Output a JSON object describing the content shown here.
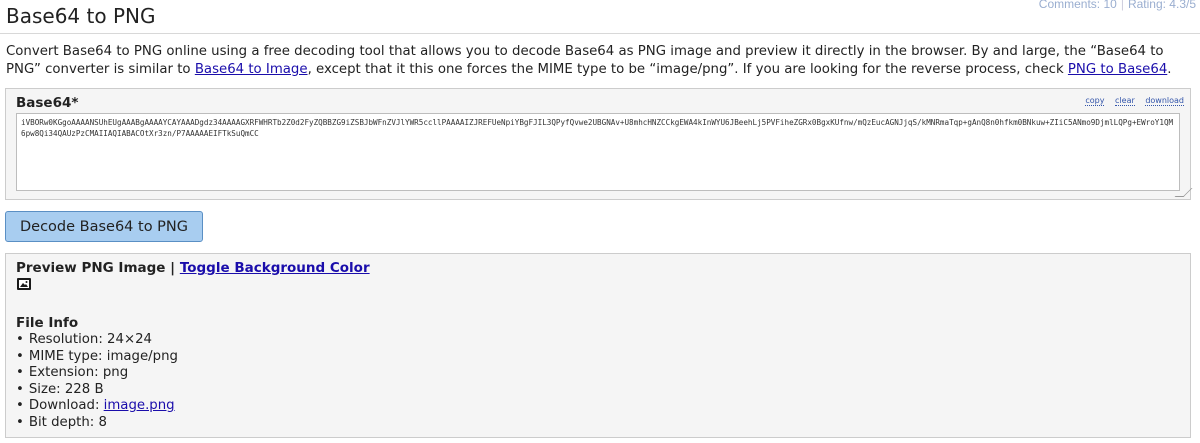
{
  "topbar": {
    "comments": "Comments: 10",
    "rating": "Rating: 4.3/5"
  },
  "page_title": "Base64 to PNG",
  "intro": {
    "text1": "Convert Base64 to PNG online using a free decoding tool that allows you to decode Base64 as PNG image and preview it directly in the browser. By and large, the “Base64 to PNG” converter is similar to ",
    "link1": "Base64 to Image",
    "text2": ", except that it this one forces the MIME type to be “image/png”. If you are looking for the reverse process, check ",
    "link2": "PNG to Base64",
    "text3": "."
  },
  "input": {
    "label": "Base64*",
    "tools": [
      "copy",
      "clear",
      "download"
    ],
    "value": "iVBORw0KGgoAAAANSUhEUgAAABgAAAAYCAYAAADgdz34AAAAGXRFWHRTb2Z0d2FyZQBBZG9iZSBJbWFnZVJlYWR5ccllPAAAAIZJREFUeNpiYBgFJIL3QPyfQvwe2UBGNAv+U8mhcHNZCCkgEWA4kInWYU6JBeehLj5PVFiheZGRx0BgxKUfnw/mQzEucAGNJjqS/kMNRmaTqp+gAnQ8n0hfkm0BNkuw+ZIiC5ANmo9DjmlLQPg+EWroY1QM6pw8Qi34QAUzPzCMAIIAQIABACOtXr3zn/P7AAAAAEIFTkSuQmCC"
  },
  "decode_button": "Decode Base64 to PNG",
  "output": {
    "preview_label": "Preview PNG Image",
    "separator": "|",
    "toggle_link": "Toggle Background Color",
    "file_info_title": "File Info",
    "info": {
      "resolution": "Resolution: 24×24",
      "mime": "MIME type: image/png",
      "extension": "Extension: png",
      "size": "Size: 228 B",
      "download_label": "Download: ",
      "download_link": "image.png",
      "bit_depth": "Bit depth: 8"
    }
  },
  "icons": {
    "preview": "image-icon"
  },
  "colors": {
    "link": "#1a0dab",
    "button_bg": "#a8cdf0",
    "panel_bg": "#f5f5f5"
  }
}
